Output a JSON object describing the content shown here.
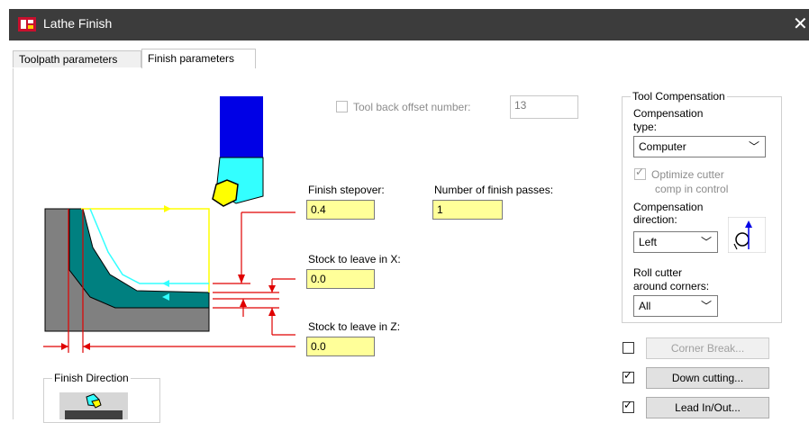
{
  "window": {
    "title": "Lathe Finish",
    "close_glyph": "✕"
  },
  "tabs": [
    {
      "label": "Toolpath parameters",
      "active": false
    },
    {
      "label": "Finish parameters",
      "active": true
    }
  ],
  "tool_back_offset": {
    "label": "Tool back offset number:",
    "value": "13",
    "checked": false,
    "enabled": false
  },
  "finish_stepover": {
    "label": "Finish stepover:",
    "value": "0.4"
  },
  "finish_passes": {
    "label": "Number of finish passes:",
    "value": "1"
  },
  "stock_x": {
    "label": "Stock to leave in X:",
    "value": "0.0"
  },
  "stock_z": {
    "label": "Stock to leave in Z:",
    "value": "0.0"
  },
  "finish_direction": {
    "title": "Finish Direction"
  },
  "tool_compensation": {
    "title": "Tool Compensation",
    "type_label_1": "Compensation",
    "type_label_2": "type:",
    "type_value": "Computer",
    "optimize_label_1": "Optimize cutter",
    "optimize_label_2": "comp in control",
    "optimize_checked": true,
    "direction_label_1": "Compensation",
    "direction_label_2": "direction:",
    "direction_value": "Left",
    "roll_label_1": "Roll cutter",
    "roll_label_2": "around corners:",
    "roll_value": "All"
  },
  "buttons": {
    "corner_break": {
      "label": "Corner Break...",
      "checked": false,
      "enabled": false
    },
    "down_cutting": {
      "label": "Down cutting...",
      "checked": true,
      "enabled": true
    },
    "lead_in_out": {
      "label": "Lead In/Out...",
      "checked": true,
      "enabled": true
    }
  },
  "colors": {
    "title_bar": "#3c3c3c",
    "input_highlight": "#ffff99",
    "tool_holder": "#0000e6",
    "tool_body": "#33ffff",
    "insert": "#ffff00",
    "part_gray": "#808080",
    "finish_teal": "#008080",
    "dimension_red": "#e00000"
  }
}
